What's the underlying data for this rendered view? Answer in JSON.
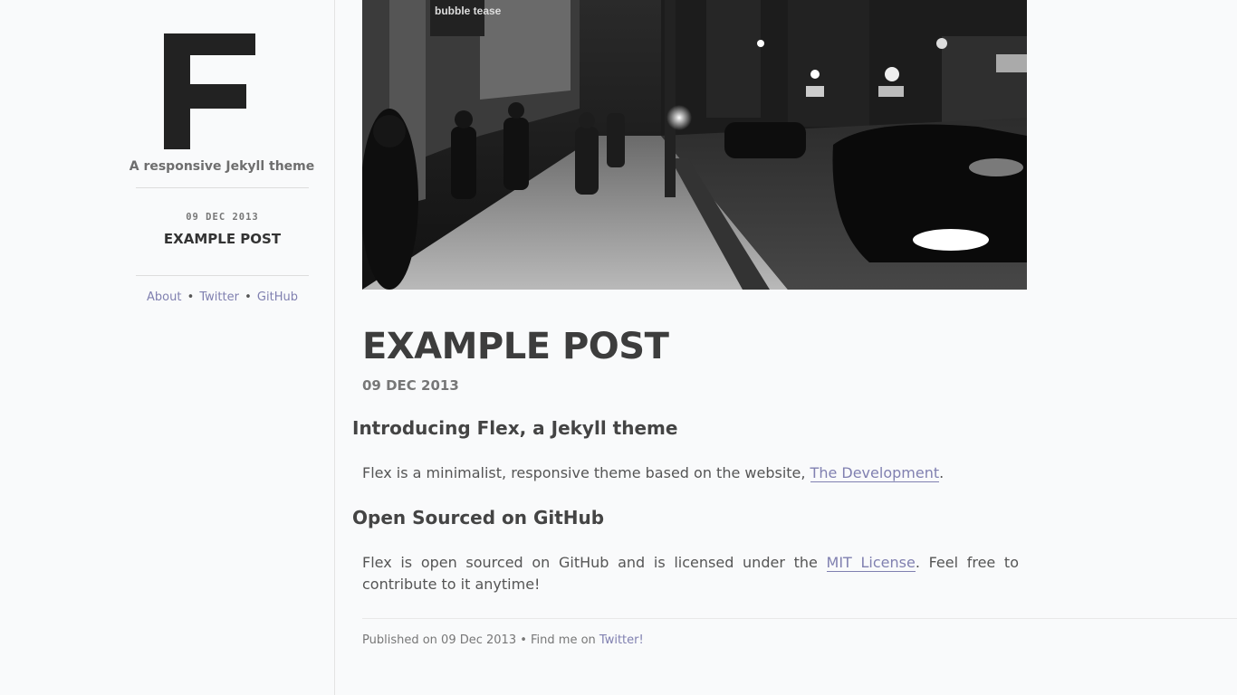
{
  "sidebar": {
    "logo_letter": "F",
    "tagline": "A responsive Jekyll theme",
    "post_date": "09 DEC 2013",
    "post_title": "EXAMPLE POST",
    "nav": [
      {
        "label": "About"
      },
      {
        "label": "Twitter"
      },
      {
        "label": "GitHub"
      }
    ],
    "nav_separator": "•"
  },
  "hero": {
    "sign_text": "bubble tease"
  },
  "post": {
    "title": "EXAMPLE POST",
    "date": "09 DEC 2013",
    "sections": [
      {
        "heading": "Introducing Flex, a Jekyll theme",
        "text_before": "Flex is a minimalist, responsive theme based on the website, ",
        "link": "The Development",
        "text_after": "."
      },
      {
        "heading": "Open Sourced on GitHub",
        "text_before": "Flex is open sourced on GitHub and is licensed under the ",
        "link": "MIT License",
        "text_after": ". Feel free to contribute to it anytime!"
      }
    ]
  },
  "footer": {
    "text": "Published on 09 Dec 2013 • Find me on ",
    "link": "Twitter!"
  },
  "colors": {
    "background": "#f9fafb",
    "link": "#8080b0",
    "heading": "#3d3d3d"
  }
}
